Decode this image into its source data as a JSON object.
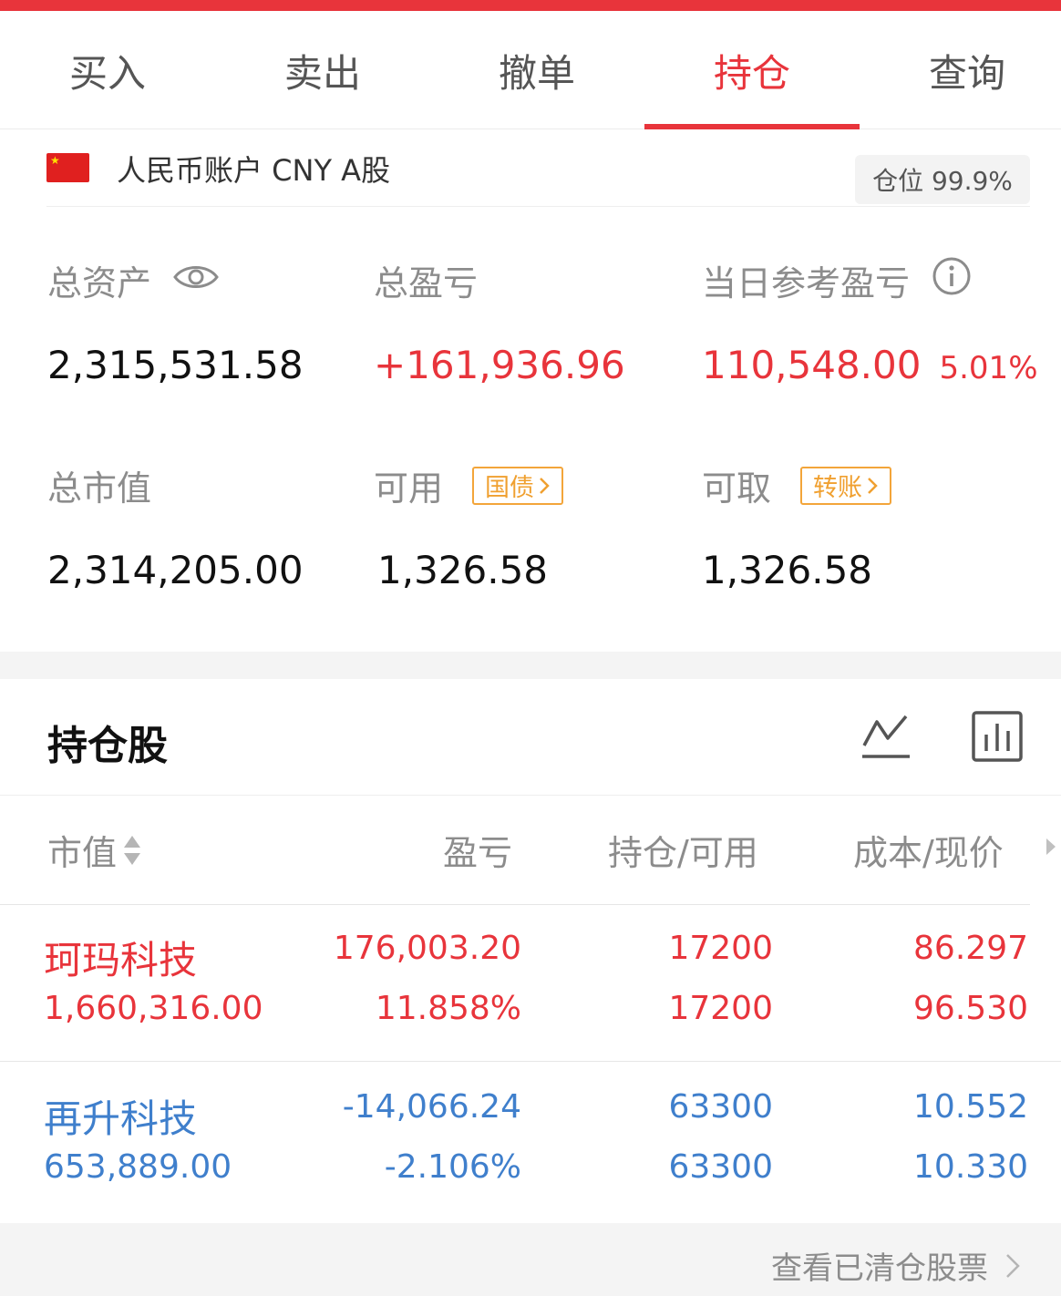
{
  "tabs": [
    {
      "label": "买入",
      "active": false
    },
    {
      "label": "卖出",
      "active": false
    },
    {
      "label": "撤单",
      "active": false
    },
    {
      "label": "持仓",
      "active": true
    },
    {
      "label": "查询",
      "active": false
    }
  ],
  "account": {
    "label": "人民币账户 CNY A股",
    "position_label": "仓位 99.9%"
  },
  "metrics": {
    "total_assets_label": "总资产",
    "total_assets_value": "2,315,531.58",
    "total_pnl_label": "总盈亏",
    "total_pnl_value": "+161,936.96",
    "daily_pnl_label": "当日参考盈亏",
    "daily_pnl_value": "110,548.00",
    "daily_pnl_pct": "5.01%",
    "market_value_label": "总市值",
    "market_value_value": "2,314,205.00",
    "available_label": "可用",
    "available_tag": "国债",
    "available_value": "1,326.58",
    "withdrawable_label": "可取",
    "withdrawable_tag": "转账",
    "withdrawable_value": "1,326.58"
  },
  "holdings": {
    "title": "持仓股",
    "headers": {
      "market_value": "市值",
      "pnl": "盈亏",
      "position": "持仓/可用",
      "cost": "成本/现价"
    },
    "rows": [
      {
        "name": "珂玛科技",
        "market_value": "1,660,316.00",
        "pnl": "176,003.20",
        "pnl_pct": "11.858%",
        "position": "17200",
        "available": "17200",
        "cost": "86.297",
        "price": "96.530",
        "color": "#e8343b"
      },
      {
        "name": "再升科技",
        "market_value": "653,889.00",
        "pnl": "-14,066.24",
        "pnl_pct": "-2.106%",
        "position": "63300",
        "available": "63300",
        "cost": "10.552",
        "price": "10.330",
        "color": "#3f7fcc"
      }
    ]
  },
  "footer": {
    "cleared_link": "查看已清仓股票"
  },
  "colors": {
    "accent": "#e8343b",
    "loss": "#3f7fcc",
    "tag": "#f0a030"
  }
}
